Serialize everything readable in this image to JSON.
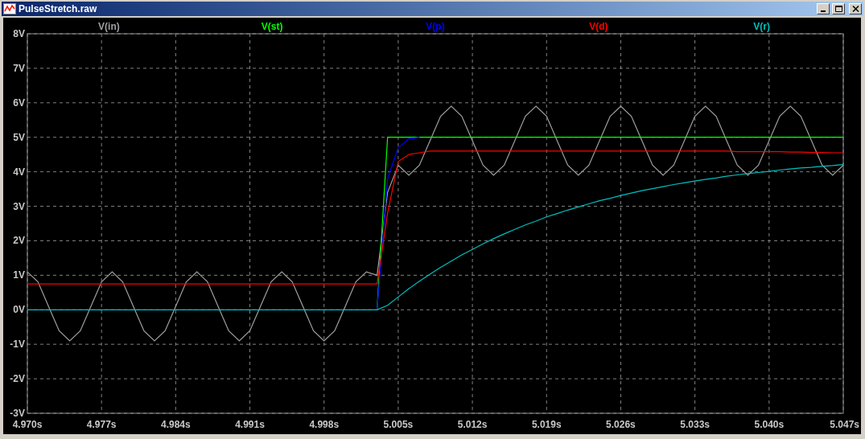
{
  "window": {
    "title": "PulseStretch.raw"
  },
  "plot": {
    "chart_data": {
      "type": "line",
      "grid": true,
      "xlim": [
        4.97,
        5.047
      ],
      "ylim": [
        -3,
        8
      ],
      "xticks": [
        {
          "value": 4.97,
          "label": "4.970s"
        },
        {
          "value": 4.977,
          "label": "4.977s"
        },
        {
          "value": 4.984,
          "label": "4.984s"
        },
        {
          "value": 4.991,
          "label": "4.991s"
        },
        {
          "value": 4.998,
          "label": "4.998s"
        },
        {
          "value": 5.005,
          "label": "5.005s"
        },
        {
          "value": 5.012,
          "label": "5.012s"
        },
        {
          "value": 5.019,
          "label": "5.019s"
        },
        {
          "value": 5.026,
          "label": "5.026s"
        },
        {
          "value": 5.033,
          "label": "5.033s"
        },
        {
          "value": 5.04,
          "label": "5.040s"
        },
        {
          "value": 5.047,
          "label": "5.047s"
        }
      ],
      "yticks": [
        {
          "value": 8,
          "label": "8V"
        },
        {
          "value": 7,
          "label": "7V"
        },
        {
          "value": 6,
          "label": "6V"
        },
        {
          "value": 5,
          "label": "5V"
        },
        {
          "value": 4,
          "label": "4V"
        },
        {
          "value": 3,
          "label": "3V"
        },
        {
          "value": 2,
          "label": "2V"
        },
        {
          "value": 1,
          "label": "1V"
        },
        {
          "value": 0,
          "label": "0V"
        },
        {
          "value": -1,
          "label": "-1V"
        },
        {
          "value": -2,
          "label": "-2V"
        },
        {
          "value": -3,
          "label": "-3V"
        }
      ],
      "x": [
        4.97,
        4.971,
        4.972,
        4.973,
        4.974,
        4.975,
        4.976,
        4.977,
        4.978,
        4.979,
        4.98,
        4.981,
        4.982,
        4.983,
        4.984,
        4.985,
        4.986,
        4.987,
        4.988,
        4.989,
        4.99,
        4.991,
        4.992,
        4.993,
        4.994,
        4.995,
        4.996,
        4.997,
        4.998,
        4.999,
        5.0,
        5.001,
        5.002,
        5.003,
        5.004,
        5.005,
        5.006,
        5.007,
        5.008,
        5.009,
        5.01,
        5.011,
        5.012,
        5.013,
        5.014,
        5.015,
        5.016,
        5.017,
        5.018,
        5.019,
        5.02,
        5.021,
        5.022,
        5.023,
        5.024,
        5.025,
        5.026,
        5.027,
        5.028,
        5.029,
        5.03,
        5.031,
        5.032,
        5.033,
        5.034,
        5.035,
        5.036,
        5.037,
        5.038,
        5.039,
        5.04,
        5.041,
        5.042,
        5.043,
        5.044,
        5.045,
        5.046,
        5.047
      ],
      "series": [
        {
          "name": "V(in)",
          "color": "#a0a0a0",
          "values": [
            1.1,
            0.81,
            0.1,
            -0.61,
            -0.9,
            -0.61,
            0.1,
            0.81,
            1.1,
            0.81,
            0.1,
            -0.61,
            -0.9,
            -0.61,
            0.1,
            0.81,
            1.1,
            0.81,
            0.1,
            -0.61,
            -0.9,
            -0.61,
            0.1,
            0.81,
            1.1,
            0.81,
            0.1,
            -0.61,
            -0.9,
            -0.61,
            0.1,
            0.81,
            1.1,
            1.0,
            3.4,
            4.19,
            3.9,
            4.19,
            4.9,
            5.61,
            5.9,
            5.61,
            4.9,
            4.19,
            3.9,
            4.19,
            4.9,
            5.61,
            5.9,
            5.61,
            4.9,
            4.19,
            3.9,
            4.19,
            4.9,
            5.61,
            5.9,
            5.61,
            4.9,
            4.19,
            3.9,
            4.19,
            4.9,
            5.61,
            5.9,
            5.61,
            4.9,
            4.19,
            3.9,
            4.19,
            4.9,
            5.61,
            5.9,
            5.61,
            4.9,
            4.19,
            3.9,
            4.19
          ]
        },
        {
          "name": "V(st)",
          "color": "#00ff00",
          "values": [
            null,
            null,
            null,
            null,
            null,
            null,
            null,
            null,
            null,
            null,
            null,
            null,
            null,
            null,
            null,
            null,
            null,
            null,
            null,
            null,
            null,
            null,
            null,
            null,
            null,
            null,
            null,
            null,
            null,
            null,
            null,
            null,
            null,
            0,
            5,
            5,
            5,
            5,
            5,
            5,
            5,
            5,
            5,
            5,
            5,
            5,
            5,
            5,
            5,
            5,
            5,
            5,
            5,
            5,
            5,
            5,
            5,
            5,
            5,
            5,
            5,
            5,
            5,
            5,
            5,
            5,
            5,
            5,
            5,
            5,
            5,
            5,
            5,
            5,
            5,
            5,
            5,
            5
          ]
        },
        {
          "name": "V(p)",
          "color": "#0000ff",
          "values": [
            null,
            null,
            null,
            null,
            null,
            null,
            null,
            null,
            null,
            null,
            null,
            null,
            null,
            null,
            null,
            null,
            null,
            null,
            null,
            null,
            null,
            null,
            null,
            null,
            null,
            null,
            null,
            null,
            null,
            null,
            null,
            null,
            null,
            0,
            3.8,
            4.7,
            4.95,
            5.0,
            null,
            null,
            null,
            null,
            null,
            null,
            null,
            null,
            null,
            null,
            null,
            null,
            null,
            null,
            null,
            null,
            null,
            null,
            null,
            null,
            null,
            null,
            null,
            null,
            null,
            null,
            null,
            null,
            null,
            null,
            null,
            null,
            null,
            null,
            null,
            null,
            null,
            null,
            null,
            null
          ]
        },
        {
          "name": "V(d)",
          "color": "#ff0000",
          "values": [
            0.75,
            0.75,
            0.75,
            0.75,
            0.75,
            0.75,
            0.75,
            0.75,
            0.75,
            0.75,
            0.75,
            0.75,
            0.75,
            0.75,
            0.75,
            0.75,
            0.75,
            0.75,
            0.75,
            0.75,
            0.75,
            0.75,
            0.75,
            0.75,
            0.75,
            0.75,
            0.75,
            0.75,
            0.75,
            0.75,
            0.75,
            0.75,
            0.75,
            0.75,
            2.8,
            4.3,
            4.5,
            4.55,
            4.6,
            4.6,
            4.6,
            4.6,
            4.6,
            4.6,
            4.6,
            4.6,
            4.6,
            4.6,
            4.6,
            4.6,
            4.6,
            4.6,
            4.6,
            4.6,
            4.6,
            4.6,
            4.6,
            4.6,
            4.6,
            4.6,
            4.6,
            4.6,
            4.6,
            4.6,
            4.6,
            4.6,
            4.6,
            4.58,
            4.58,
            4.58,
            4.58,
            4.58,
            4.57,
            4.57,
            4.56,
            4.56,
            4.55,
            4.55
          ]
        },
        {
          "name": "V(r)",
          "color": "#00c0c0",
          "values": [
            0,
            0,
            0,
            0,
            0,
            0,
            0,
            0,
            0,
            0,
            0,
            0,
            0,
            0,
            0,
            0,
            0,
            0,
            0,
            0,
            0,
            0,
            0,
            0,
            0,
            0,
            0,
            0,
            0,
            0,
            0,
            0,
            0,
            0,
            0.13,
            0.37,
            0.61,
            0.83,
            1.03,
            1.23,
            1.41,
            1.59,
            1.75,
            1.91,
            2.06,
            2.2,
            2.33,
            2.46,
            2.57,
            2.69,
            2.79,
            2.89,
            2.98,
            3.07,
            3.16,
            3.23,
            3.31,
            3.38,
            3.45,
            3.51,
            3.57,
            3.63,
            3.68,
            3.73,
            3.78,
            3.82,
            3.87,
            3.91,
            3.95,
            3.98,
            4.01,
            4.05,
            4.08,
            4.11,
            4.13,
            4.16,
            4.18,
            4.21
          ]
        }
      ]
    }
  }
}
